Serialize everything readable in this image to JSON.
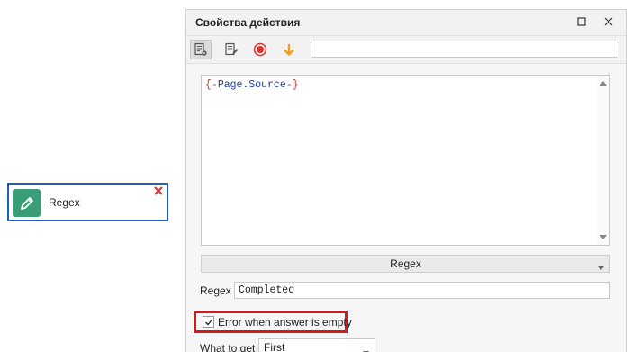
{
  "node": {
    "label": "Regex",
    "icon": "pencil-icon",
    "close_icon": "close-icon",
    "accent": "#3a9d78",
    "border_color": "#1f5fbf"
  },
  "panel": {
    "title": "Свойства действия",
    "window_buttons": [
      "maximize-icon",
      "close-icon"
    ],
    "toolbar": {
      "buttons": [
        "properties-icon",
        "edit-note-icon",
        "record-icon",
        "arrow-down-icon"
      ],
      "search_value": ""
    },
    "editor": {
      "code": {
        "open": "{-",
        "part1": "Page",
        "dot": ".",
        "part2": "Source",
        "close": "-}"
      }
    },
    "mode_dropdown": "Regex",
    "regex": {
      "label": "Regex",
      "value": "Completed"
    },
    "error_option": {
      "checked": true,
      "label": "Error  when answer is empty"
    },
    "what_to_get": {
      "label": "What to get",
      "selected": "First"
    }
  }
}
